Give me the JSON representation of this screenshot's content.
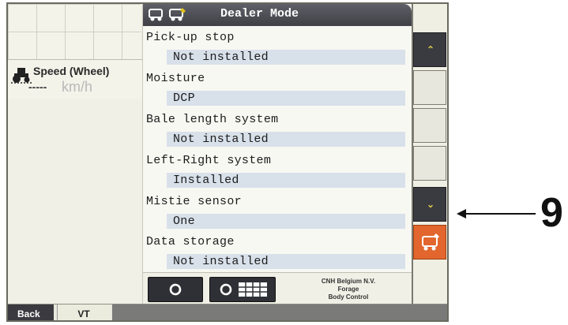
{
  "header": {
    "title": "Dealer Mode",
    "icons": [
      "baler-icon",
      "baler-settings-icon"
    ]
  },
  "speed_widget": {
    "title": "Speed (Wheel)",
    "value": "-----",
    "unit": "km/h",
    "icon": "tractor-icon"
  },
  "settings": [
    {
      "label": "Pick-up stop",
      "value": "Not installed"
    },
    {
      "label": "Moisture",
      "value": "DCP"
    },
    {
      "label": "Bale length system",
      "value": "Not installed"
    },
    {
      "label": "Left-Right system",
      "value": "Installed"
    },
    {
      "label": "Mistie sensor",
      "value": "One"
    },
    {
      "label": "Data storage",
      "value": "Not installed"
    }
  ],
  "bottom_bar": {
    "company_line1": "CNH Belgium N.V.",
    "company_line2": "Forage",
    "company_line3": "Body Control",
    "buttons": [
      "refresh-icon",
      "refresh-grid-icon"
    ]
  },
  "softkeys": [
    "scroll-up-icon",
    "",
    "",
    "",
    "scroll-down-icon",
    "baler-home-icon"
  ],
  "tabs": {
    "back": "Back",
    "vt": "VT"
  },
  "annotation": {
    "callout": "9"
  },
  "colors": {
    "header_bg": "#4a4b51",
    "value_bg": "#d8e0ea",
    "orange_key": "#e2662d",
    "chevron": "#d9c54a"
  }
}
